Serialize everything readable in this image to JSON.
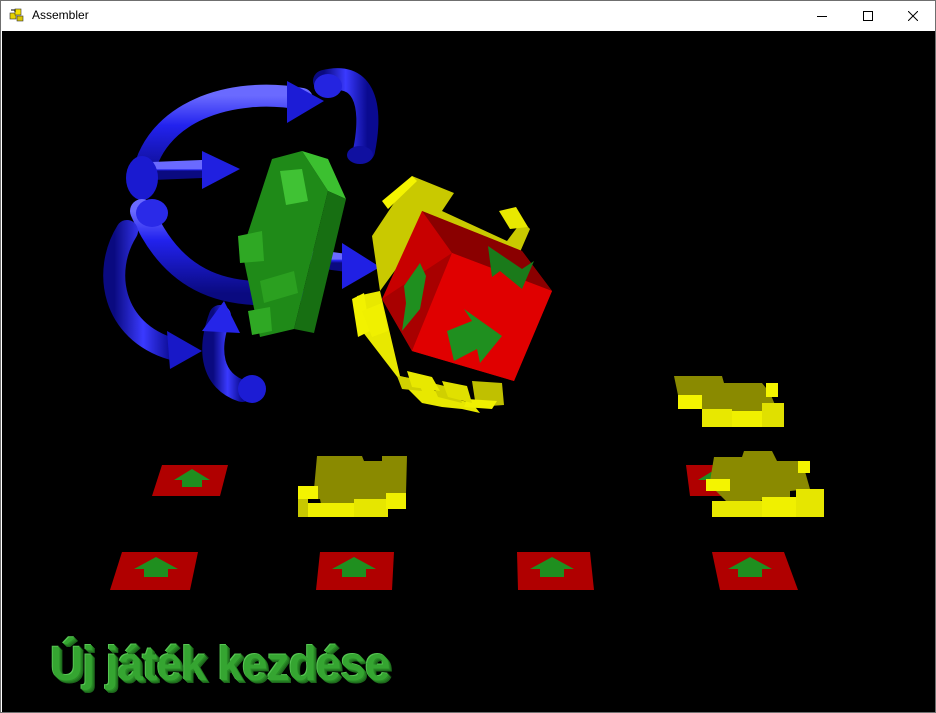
{
  "window": {
    "title": "Assembler",
    "icon": "assembler-app-icon",
    "controls": {
      "minimize_icon": "minimize-icon",
      "maximize_icon": "maximize-icon",
      "close_icon": "close-icon"
    }
  },
  "scene": {
    "background_color": "#000000",
    "colors": {
      "rotation_arrows": "#1a1ad9",
      "green_piece": "#2a9a1e",
      "cube_red": "#d40000",
      "frame_yellow": "#e8e800",
      "arrow_green": "#1f8f1f"
    },
    "menu_item": "Új játék kezdése"
  }
}
